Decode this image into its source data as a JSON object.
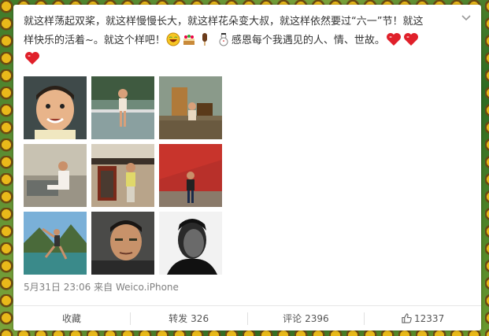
{
  "post": {
    "text_line1": "就这样荡起双桨，就这样慢慢长大，就这样花朵变大叔，就这样依然要过“六一”节！就这",
    "text_line2_a": "样快乐的活着~。就这个样吧！",
    "text_line2_b": "感恩每个我遇见的人、情、世故。",
    "timestamp": "5月31日 23:06",
    "source_prefix": "来自",
    "source": "Weico.iPhone"
  },
  "photos": [
    {
      "desc": "child-portrait"
    },
    {
      "desc": "boy-by-pond"
    },
    {
      "desc": "boy-indoors"
    },
    {
      "desc": "teen-on-bed"
    },
    {
      "desc": "boy-by-gate"
    },
    {
      "desc": "red-wall-banner"
    },
    {
      "desc": "beach-pose"
    },
    {
      "desc": "man-closeup-color"
    },
    {
      "desc": "man-portrait-bw"
    }
  ],
  "actions": {
    "favorite_label": "收藏",
    "repost_label": "转发",
    "repost_count": "326",
    "comment_label": "评论",
    "comment_count": "2396",
    "like_count": "12337"
  },
  "icons": {
    "menu": "chevron-down-icon",
    "emoji1": "laughing-face-icon",
    "emoji2": "cake-icon",
    "emoji3": "popsicle-icon",
    "emoji4": "snowman-icon",
    "heart": "red-heart-icon",
    "like": "thumbs-up-icon"
  },
  "colors": {
    "text": "#333333",
    "meta": "#808080",
    "heart": "#e0202a"
  }
}
